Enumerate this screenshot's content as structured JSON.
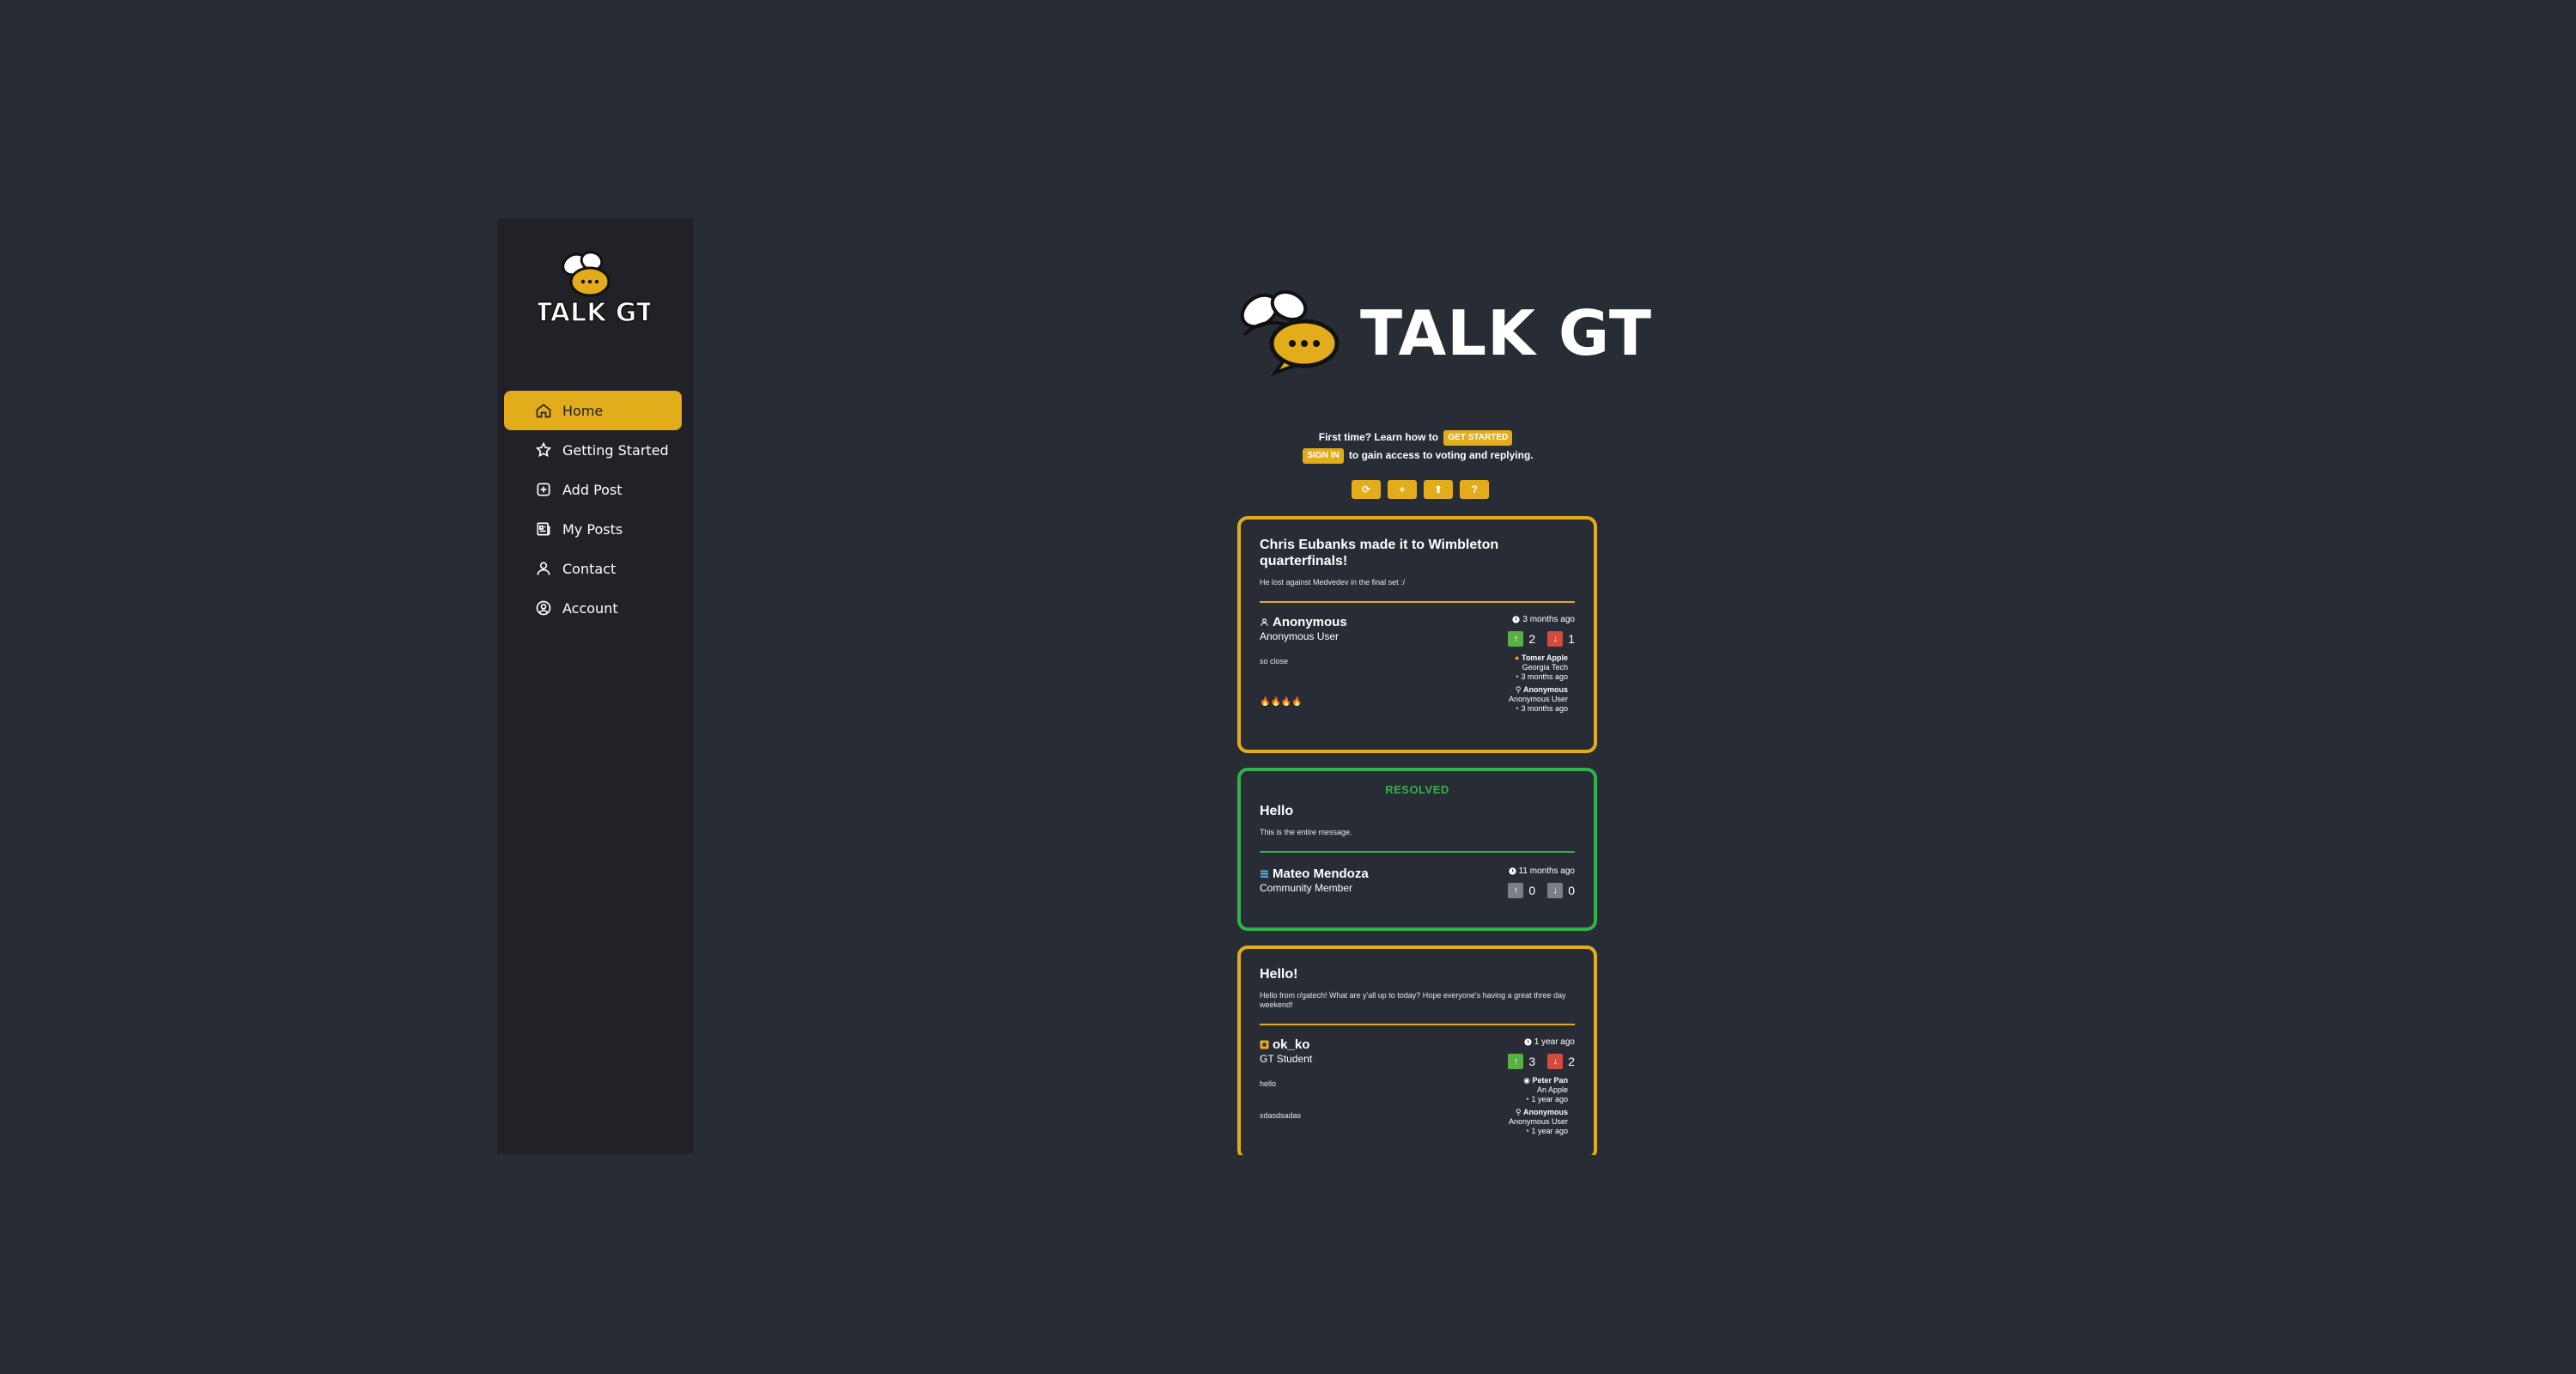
{
  "brand": {
    "title": "TALK GT",
    "colors": {
      "accent": "#e2ac1a",
      "resolved": "#2fb34a",
      "background": "#282c35",
      "sidebar": "#202228"
    }
  },
  "sidebar": {
    "items": [
      {
        "label": "Home",
        "icon": "home-icon",
        "active": true
      },
      {
        "label": "Getting Started",
        "icon": "star-icon",
        "active": false
      },
      {
        "label": "Add Post",
        "icon": "plus-square-icon",
        "active": false
      },
      {
        "label": "My Posts",
        "icon": "newspaper-icon",
        "active": false
      },
      {
        "label": "Contact",
        "icon": "user-icon",
        "active": false
      },
      {
        "label": "Account",
        "icon": "user-circle-icon",
        "active": false
      }
    ]
  },
  "intro": {
    "line1_prefix": "First time? Learn how to",
    "get_started_label": "GET STARTED",
    "sign_in_label": "SIGN IN",
    "line2_suffix": "to gain access to voting and replying."
  },
  "toolbar": {
    "buttons": [
      {
        "glyph": "⟳",
        "icon": "refresh-icon"
      },
      {
        "glyph": "+",
        "icon": "add-icon"
      },
      {
        "glyph": "⬆",
        "icon": "sort-icon"
      },
      {
        "glyph": "?",
        "icon": "help-icon"
      }
    ]
  },
  "posts": [
    {
      "title": "Chris Eubanks made it to Wimbleton quarterfinals!",
      "body": "He lost against Medvedev in the final set :/",
      "author": "Anonymous",
      "role": "Anonymous User",
      "time": "3 months ago",
      "upvotes": "2",
      "downvotes": "1",
      "replies": [
        {
          "text": "so close",
          "name": "Tomer Apple",
          "role": "Georgia Tech",
          "time": "3 months ago"
        },
        {
          "text": "🔥🔥🔥🔥",
          "name": "Anonymous",
          "role": "Anonymous User",
          "time": "3 months ago"
        }
      ]
    },
    {
      "status": "RESOLVED",
      "title": "Hello",
      "body": "This is the entire message.",
      "author": "Mateo Mendoza",
      "role": "Community Member",
      "time": "11 months ago",
      "upvotes": "0",
      "downvotes": "0"
    },
    {
      "title": "Hello!",
      "body": "Hello from r/gatech! What are y'all up to today? Hope everyone's having a great three day weekend!",
      "author": "ok_ko",
      "role": "GT Student",
      "time": "1 year ago",
      "upvotes": "3",
      "downvotes": "2",
      "replies": [
        {
          "text": "hello",
          "name": "Peter Pan",
          "role": "An Apple",
          "time": "1 year ago"
        },
        {
          "text": "sdasdsadas",
          "name": "Anonymous",
          "role": "Anonymous User",
          "time": "1 year ago"
        }
      ]
    }
  ]
}
